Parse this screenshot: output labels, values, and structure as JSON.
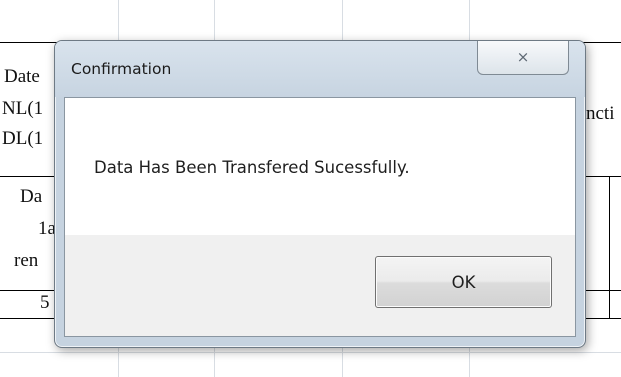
{
  "spreadsheet": {
    "cells": [
      {
        "id": "date",
        "text": "Date"
      },
      {
        "id": "nl",
        "text": "NL(1"
      },
      {
        "id": "dl",
        "text": "DL(1"
      },
      {
        "id": "dat",
        "text": "Da"
      },
      {
        "id": "one",
        "text": "1a"
      },
      {
        "id": "ren",
        "text": "ren"
      },
      {
        "id": "five",
        "text": "5"
      },
      {
        "id": "ncti",
        "text": "ncti"
      }
    ]
  },
  "dialog": {
    "title": "Confirmation",
    "close_icon": "×",
    "message": "Data Has Been Transfered Sucessfully.",
    "ok_label": "OK"
  },
  "colors": {
    "dialog_frame": "#c6d3e0",
    "client_background": "#f0f0f0",
    "message_background": "#ffffff"
  }
}
